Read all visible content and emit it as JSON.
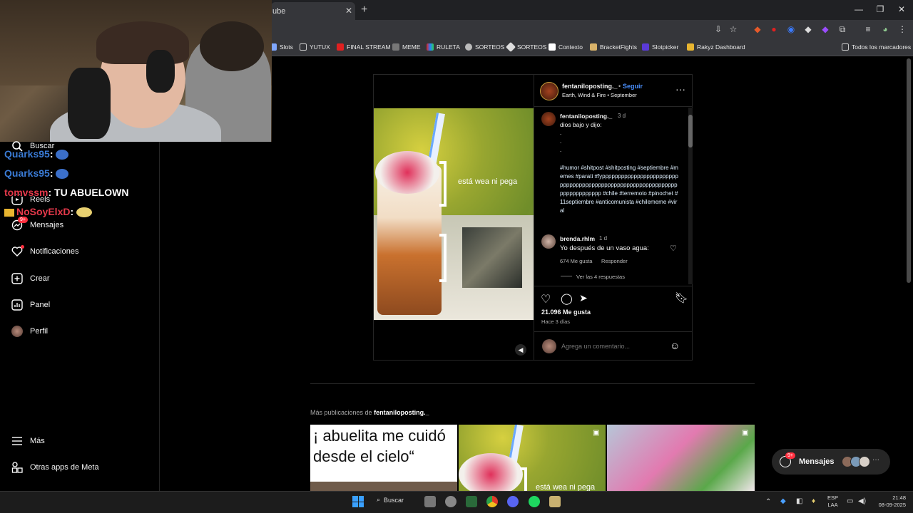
{
  "browser": {
    "tab_title": "ube",
    "bookmarks": [
      "Slots",
      "YUTUX",
      "FINAL STREAM",
      "MEME",
      "RULETA",
      "SORTEOS",
      "SORTEOS",
      "Contexto",
      "BracketFights",
      "Slotpicker",
      "Rakyz Dashboard"
    ],
    "all_bookmarks": "Todos los marcadores"
  },
  "chat": [
    {
      "user": "Quarks95",
      "message": ":",
      "color": "#3a7bd5"
    },
    {
      "user": "Quarks95",
      "message": ":",
      "color": "#3a7bd5"
    },
    {
      "user": "tomvssm",
      "message": ": TU ABUELOWN",
      "color": "#e6394b"
    },
    {
      "user": "NoSoyElxD",
      "message": ":",
      "color": "#e6394b"
    }
  ],
  "sidebar": {
    "search": "Buscar",
    "reels": "Reels",
    "messages": "Mensajes",
    "messages_badge": "9+",
    "notifications": "Notificaciones",
    "create": "Crear",
    "panel": "Panel",
    "profile": "Perfil",
    "more": "Más",
    "other_apps": "Otras apps de Meta"
  },
  "post": {
    "username": "fentaniloposting._",
    "follow": "Seguir",
    "audio": "Earth, Wind & Fire • September",
    "caption_user": "fentaniloposting._",
    "caption_time": "3 d",
    "caption_lines": [
      "dios bajo y dijo:",
      ".",
      ".",
      "."
    ],
    "hashtags": "#humor #shitpost #shitposting #septiembre #memes #parati #fypppppppppppppppppppppppppppppppppppppppppppppppppppppppppppppppppppppppppp #chile #terremoto #pinochet #11septiembre #anticomunista #chilememe #viral",
    "media_caption": "está wea ni pega",
    "comment_user": "brenda.rhlm",
    "comment_time": "1 d",
    "comment_text": "Yo después de un vaso agua:",
    "comment_likes": "674 Me gusta",
    "comment_reply": "Responder",
    "view_replies": "Ver las 4 respuestas",
    "likes": "21.096 Me gusta",
    "time_ago": "Hace 3 días",
    "add_comment_placeholder": "Agrega un comentario..."
  },
  "more_posts": {
    "label": "Más publicaciones de",
    "username": "fentaniloposting._",
    "thumb1_text": "¡ abuelita me cuidó desde el cielo“",
    "thumb2_text": "está wea ni pega"
  },
  "messages_pill": {
    "label": "Mensajes",
    "badge": "9+"
  },
  "taskbar": {
    "search": "Buscar",
    "lang1": "ESP",
    "lang2": "LAA",
    "time": "21:48",
    "date": "08-09-2025"
  },
  "colors": {
    "accent_blue": "#4a90ff",
    "hashtag": "#e0f1ff",
    "badge_red": "#ff3040"
  }
}
